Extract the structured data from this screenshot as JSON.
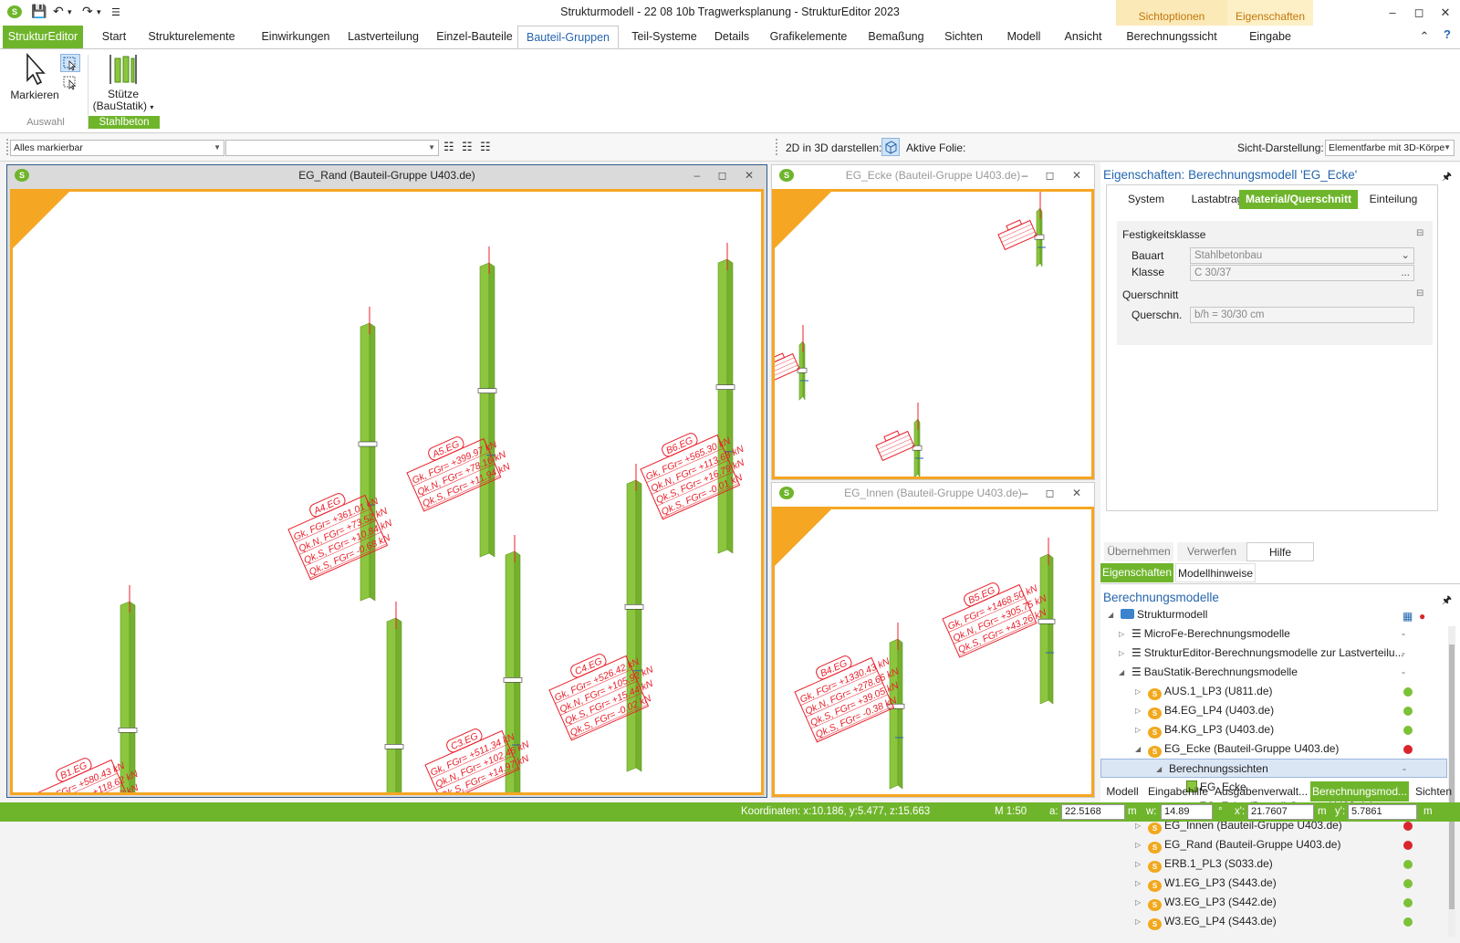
{
  "window": {
    "title": "Strukturmodell - 22 08 10b Tragwerksplanung - StrukturEditor 2023"
  },
  "context_tabs": [
    {
      "group": "Sichtoptionen",
      "tab": "Berechnungssicht"
    },
    {
      "group": "Eigenschaften",
      "tab": "Eingabe"
    }
  ],
  "ribbon": {
    "file_tab": "StrukturEditor",
    "tabs": [
      "Start",
      "Strukturelemente",
      "Einwirkungen",
      "Lastverteilung",
      "Einzel-Bauteile",
      "Bauteil-Gruppen",
      "Teil-Systeme",
      "Details",
      "Grafikelemente",
      "Bemaßung",
      "Sichten",
      "Modell",
      "Ansicht"
    ],
    "active_tab": "Bauteil-Gruppen",
    "markieren": "Markieren",
    "auswahl": "Auswahl",
    "stuetze_line1": "Stütze",
    "stuetze_line2": "(BauStatik)",
    "stahlbeton": "Stahlbeton"
  },
  "toolbar": {
    "filter": "Alles markierbar",
    "second": "",
    "darstellen": "2D in 3D darstellen:",
    "folie": "Aktive Folie:",
    "sicht_label": "Sicht-Darstellung:",
    "sicht_value": "Elementfarbe mit 3D-Körpe"
  },
  "views": {
    "main": "EG_Rand (Bauteil-Gruppe U403.de)",
    "ecke": "EG_Ecke (Bauteil-Gruppe U403.de)",
    "innen": "EG_Innen (Bauteil-Gruppe U403.de)"
  },
  "columns_main": [
    {
      "name": "A4.EG",
      "lines": [
        "Gk, FGr= +361.01 kN",
        "Qk.N, FGr= +73.52 kN",
        "Qk.S, FGr= +10.84 kN",
        "Qk.S, FGr= -0.68 kN"
      ]
    },
    {
      "name": "A5.EG",
      "lines": [
        "Gk, FGr= +399.97 kN",
        "Qk.N, FGr= +78.16 kN",
        "Qk.S, FGr= +11.94 kN"
      ]
    },
    {
      "name": "B6.EG",
      "lines": [
        "Gk, FGr= +565.30 kN",
        "Qk.N, FGr= +113.63 kN",
        "Qk.S, FGr= +16.79 kN",
        "Qk.S, FGr= -0.01 kN"
      ]
    },
    {
      "name": "C4.EG",
      "lines": [
        "Gk, FGr= +526.42 kN",
        "Qk.N, FGr= +105.92 kN",
        "Qk.S, FGr= +15.44 kN",
        "Qk.S, FGr= -0.02 kN"
      ]
    },
    {
      "name": "C3.EG",
      "lines": [
        "Gk, FGr= +511.34 kN",
        "Qk.N, FGr= +102.46 kN",
        "Qk.S, FGr= +14.97 kN"
      ]
    },
    {
      "name": "B1.EG",
      "lines": [
        "Gk, FGr= +580.43 kN",
        "Qk.N, FGr= +118.62 kN",
        "Qk.S, FGr= +16.90 kN",
        "Qk.S, FGr= -0.24 kN"
      ]
    },
    {
      "name": "C2.EG",
      "lines": [
        "Gk, FGr= +572.18 kN",
        "Qk.N, FGr= +115.65 kN",
        "Qk.S, FGr= +16.67 kN"
      ]
    }
  ],
  "columns_innen": [
    {
      "name": "B4.EG",
      "lines": [
        "Gk, FGr= +1330.43 kN",
        "Qk.N, FGr= +278.66 kN",
        "Qk.S, FGr= +39.05 kN",
        "Qk.S, FGr= -0.38 kN"
      ]
    },
    {
      "name": "B5.EG",
      "lines": [
        "Gk, FGr= +1468.50 kN",
        "Qk.N, FGr= +305.75 kN",
        "Qk.S, FGr= +43.26 kN"
      ]
    }
  ],
  "props": {
    "title": "Eigenschaften: Berechnungsmodell 'EG_Ecke'",
    "tabs": [
      "System",
      "Lastabtrag",
      "Material/Querschnitt",
      "Einteilung"
    ],
    "active_tab": "Material/Querschnitt",
    "sec1": "Festigkeitsklasse",
    "bauart_label": "Bauart",
    "bauart": "Stahlbetonbau",
    "klasse_label": "Klasse",
    "klasse": "C 30/37",
    "sec2": "Querschnitt",
    "qs_label": "Querschn.",
    "qs": "b/h = 30/30 cm",
    "btn_apply": "Übernehmen",
    "btn_discard": "Verwerfen",
    "btn_help": "Hilfe",
    "panel_tab1": "Eigenschaften",
    "panel_tab2": "Modellhinweise"
  },
  "tree": {
    "title": "Berechnungsmodelle",
    "rows": [
      {
        "text": "Strukturmodell"
      },
      {
        "text": "MicroFe-Berechnungsmodelle"
      },
      {
        "text": "StrukturEditor-Berechnungsmodelle zur Lastverteilu..."
      },
      {
        "text": "BauStatik-Berechnungsmodelle"
      },
      {
        "text": "AUS.1_LP3 (U811.de)"
      },
      {
        "text": "B4.EG_LP4 (U403.de)"
      },
      {
        "text": "B4.KG_LP3 (U403.de)"
      },
      {
        "text": "EG_Ecke (Bauteil-Gruppe U403.de)"
      },
      {
        "text": "Berechnungssichten"
      },
      {
        "text": "EG_Ecke"
      },
      {
        "text": "EG_Ecke (Bauteil-Gruppe U403.de)"
      },
      {
        "text": "EG_Innen (Bauteil-Gruppe U403.de)"
      },
      {
        "text": "EG_Rand (Bauteil-Gruppe U403.de)"
      },
      {
        "text": "ERB.1_PL3 (S033.de)"
      },
      {
        "text": "W1.EG_LP3 (S443.de)"
      },
      {
        "text": "W3.EG_LP3 (S442.de)"
      },
      {
        "text": "W3.EG_LP4 (S443.de)"
      }
    ],
    "status_colors": {
      "ok": "#7cc138",
      "error": "#d9262c"
    }
  },
  "bottom_tabs": [
    "Modell",
    "Eingabehilfe",
    "Ausgabenverwalt...",
    "Berechnungsmod...",
    "Sichten"
  ],
  "status": {
    "coords": "Koordinaten: x:10.186, y:5.477, z:15.663",
    "scale": "M 1:50",
    "a_label": "a:",
    "a": "22.5168",
    "a_unit": "m",
    "w_label": "w:",
    "w": "14.89",
    "w_unit": "°",
    "x_label": "x':",
    "x": "21.7607",
    "x_unit": "m",
    "y_label": "y':",
    "y": "5.7861",
    "y_unit": "m"
  },
  "colors": {
    "accent": "#6fb52c",
    "highlight": "#f5a623",
    "label_red": "#e8202a"
  }
}
